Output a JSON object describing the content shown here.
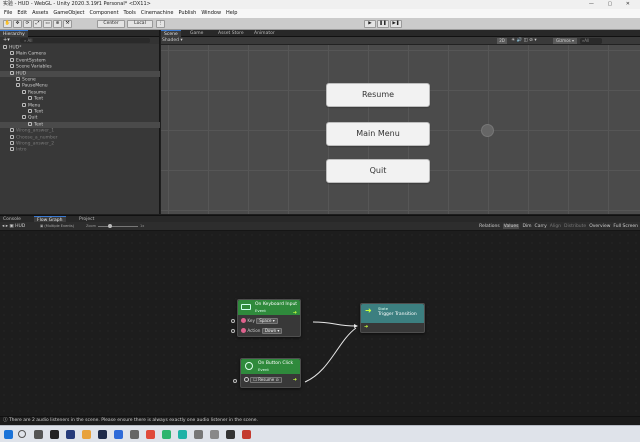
{
  "window": {
    "title": "实验 - HUD - WebGL - Unity 2020.3.19f1 Personal* <DX11>",
    "controls": "— ▢ ✕"
  },
  "menu": [
    "File",
    "Edit",
    "Assets",
    "GameObject",
    "Component",
    "Tools",
    "Cinemachine",
    "Publish",
    "Window",
    "Help"
  ],
  "toolbar": {
    "pivot": "Center",
    "space": "Local",
    "play": "▶",
    "pause": "❚❚",
    "step": "▶❚"
  },
  "hierarchy": {
    "tab": "Hierarchy",
    "search_placeholder": "All",
    "rows": [
      {
        "label": "HUD*",
        "dim": false,
        "sel": false
      },
      {
        "label": "Main Camera",
        "dim": false,
        "sel": false
      },
      {
        "label": "EventSystem",
        "dim": false,
        "sel": false
      },
      {
        "label": "Scene Variables",
        "dim": false,
        "sel": false
      },
      {
        "label": "HUD",
        "dim": false,
        "sel": true
      },
      {
        "label": "Scene",
        "dim": false,
        "sel": false
      },
      {
        "label": "PauseMenu",
        "dim": false,
        "sel": false
      },
      {
        "label": "Resume",
        "dim": false,
        "sel": false
      },
      {
        "label": "Text",
        "dim": false,
        "sel": false
      },
      {
        "label": "Menu",
        "dim": false,
        "sel": false
      },
      {
        "label": "Text",
        "dim": false,
        "sel": false
      },
      {
        "label": "Quit",
        "dim": false,
        "sel": false
      },
      {
        "label": "Text",
        "dim": false,
        "sel": true
      },
      {
        "label": "Wrong_answer_1",
        "dim": true,
        "sel": false
      },
      {
        "label": "Choose_a_number",
        "dim": true,
        "sel": false
      },
      {
        "label": "Wrong_answer_2",
        "dim": true,
        "sel": false
      },
      {
        "label": "Intro",
        "dim": true,
        "sel": false
      }
    ]
  },
  "scene": {
    "tabs": [
      "Scene",
      "Game",
      "Asset Store",
      "Animator"
    ],
    "shading": "Shaded",
    "mode_2d": "2D",
    "gizmos": "Gizmos",
    "search": "All",
    "buttons": [
      "Resume",
      "Main Menu",
      "Quit"
    ]
  },
  "bottom_tabs": [
    "Console",
    "Flow Graph",
    "Project"
  ],
  "graph": {
    "breadcrumb": "HUD",
    "selector": "(Multiple Events)",
    "zoom_label": "Zoom",
    "zoom_value": "1x",
    "tools": [
      "Relations",
      "Values",
      "Dim",
      "Carry",
      "Align",
      "Distribute",
      "Overview",
      "Full Screen"
    ],
    "nodes": {
      "keyboard": {
        "title": "On Keyboard Input",
        "sub": "Event",
        "key_label": "Key",
        "key_value": "Space",
        "action_label": "Action",
        "action_value": "Down"
      },
      "button": {
        "title": "On Button Click",
        "sub": "Event",
        "target": "Resume"
      },
      "state": {
        "sub": "State",
        "title": "Trigger Transition"
      }
    }
  },
  "status": "There are 2 audio listeners in the scene. Please ensure there is always exactly one audio listener in the scene.",
  "colors": {
    "event_green": "#2f8a3c",
    "state_teal": "#3c7f80",
    "editor_bg": "#383838",
    "selection": "#3a79d1"
  }
}
